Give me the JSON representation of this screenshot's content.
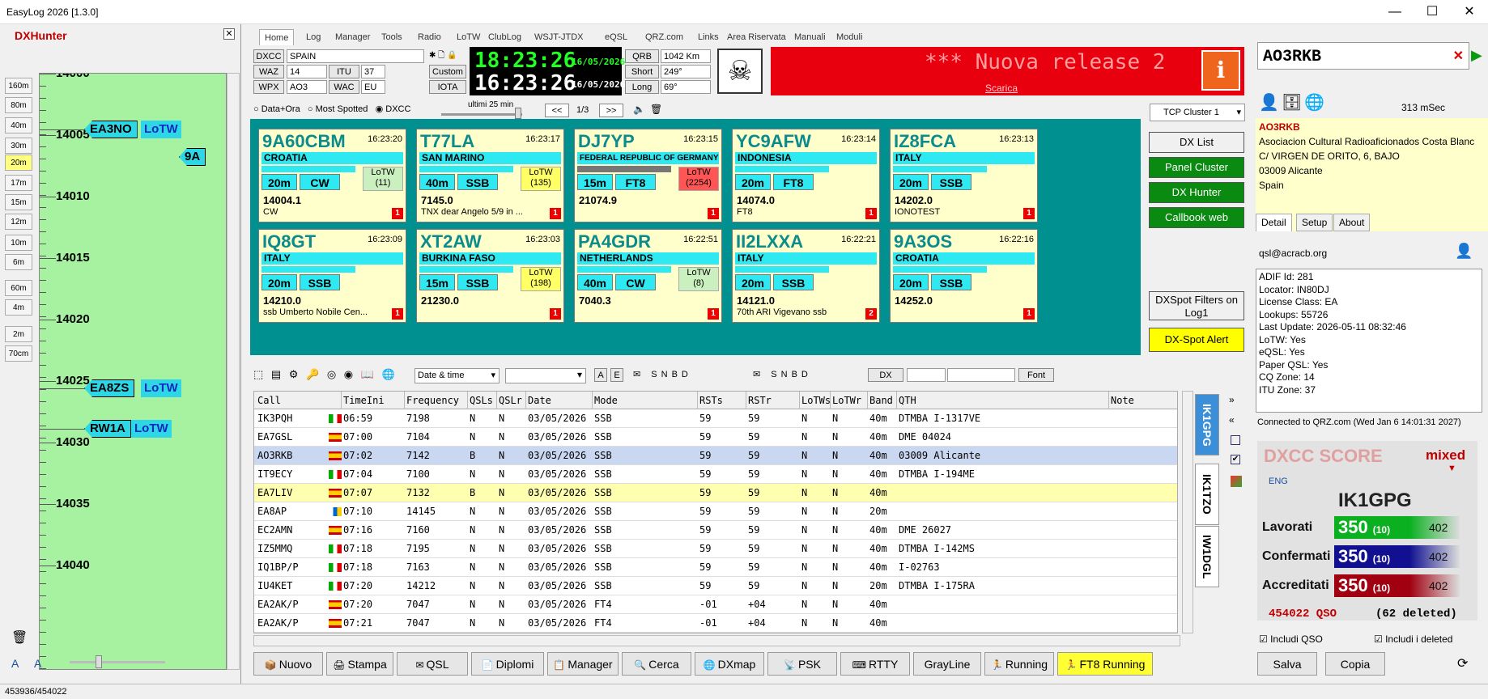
{
  "window": {
    "title": "EasyLog 2026 [1.3.0]",
    "minimize": "—",
    "maximize": "☐",
    "close": "✕"
  },
  "dxhunter": {
    "title": "DXHunter",
    "close": "✕",
    "bands": [
      "160m",
      "80m",
      "40m",
      "30m",
      "20m",
      "17m",
      "15m",
      "12m",
      "10m",
      "6m",
      "60m",
      "4m",
      "2m",
      "70cm"
    ],
    "freqs": [
      "14000",
      "14005",
      "14010",
      "14015",
      "14020",
      "14025",
      "14030",
      "14035",
      "14040"
    ],
    "spots": [
      {
        "call": "EA3NO",
        "lotw": "LoTW"
      },
      {
        "call": "EA8ZS",
        "lotw": "LoTW"
      },
      {
        "call": "RW1A",
        "lotw": "LoTW"
      },
      {
        "call": "9A",
        "lotw": ""
      }
    ]
  },
  "menu": [
    "Home",
    "Log",
    "Manager",
    "Tools",
    "Radio",
    "LoTW",
    "ClubLog",
    "WSJT-JTDX",
    "eQSL",
    "QRZ.com",
    "Links",
    "Area Riservata",
    "Manuali",
    "Moduli"
  ],
  "info": {
    "dxcc_l": "DXCC",
    "dxcc": "SPAIN",
    "waz_l": "WAZ",
    "waz": "14",
    "itu_l": "ITU",
    "itu": "37",
    "custom": "Custom",
    "wpx_l": "WPX",
    "wpx": "AO3",
    "wac_l": "WAC",
    "wac": "EU",
    "iota": "IOTA",
    "qrb_l": "QRB",
    "qrb": "1042 Km",
    "short_l": "Short",
    "short": "249°",
    "long_l": "Long",
    "long": "69°"
  },
  "clock": {
    "utc": "18:23:26",
    "local": "16:23:26",
    "date1": "16/05/2026",
    "date2": "16/05/2026"
  },
  "banner": {
    "text": "*** Nuova release 2",
    "link": "Scarica"
  },
  "filters": {
    "o1": "Data+Ora",
    "o2": "Most Spotted",
    "o3": "DXCC",
    "range": "ultimi 25 min",
    "prev": "<<",
    "page": "1/3",
    "next": ">>",
    "cluster": "TCP Cluster 1"
  },
  "cards": [
    {
      "call": "9A60CBM",
      "time": "16:23:20",
      "country": "CROATIA",
      "band": "20m",
      "mode": "CW",
      "lotw": "LoTW\n(11)",
      "lotwcolor": "#cbf0c0",
      "freq": "14004.1",
      "comment": "CW",
      "cnt": "1"
    },
    {
      "call": "T77LA",
      "time": "16:23:17",
      "country": "SAN MARINO",
      "band": "40m",
      "mode": "SSB",
      "lotw": "LoTW\n(135)",
      "lotwcolor": "#ffff66",
      "freq": "7145.0",
      "comment": "TNX dear Angelo 5/9 in ...",
      "cnt": "1"
    },
    {
      "call": "DJ7YP",
      "time": "16:23:15",
      "country": "FEDERAL REPUBLIC OF GERMANY",
      "band": "15m",
      "mode": "FT8",
      "lotw": "LoTW\n(2254)",
      "lotwcolor": "#ff5555",
      "freq": "21074.9",
      "comment": "",
      "cnt": "1"
    },
    {
      "call": "YC9AFW",
      "time": "16:23:14",
      "country": "INDONESIA",
      "band": "20m",
      "mode": "FT8",
      "lotw": "",
      "lotwcolor": "",
      "freq": "14074.0",
      "comment": "FT8",
      "cnt": "1"
    },
    {
      "call": "IZ8FCA",
      "time": "16:23:13",
      "country": "ITALY",
      "band": "20m",
      "mode": "SSB",
      "lotw": "",
      "lotwcolor": "",
      "freq": "14202.0",
      "comment": "IONOTEST",
      "cnt": "1"
    },
    {
      "call": "IQ8GT",
      "time": "16:23:09",
      "country": "ITALY",
      "band": "20m",
      "mode": "SSB",
      "lotw": "",
      "lotwcolor": "",
      "freq": "14210.0",
      "comment": "ssb Umberto Nobile Cen...",
      "cnt": "1"
    },
    {
      "call": "XT2AW",
      "time": "16:23:03",
      "country": "BURKINA FASO",
      "band": "15m",
      "mode": "SSB",
      "lotw": "LoTW\n(198)",
      "lotwcolor": "#ffff66",
      "freq": "21230.0",
      "comment": "",
      "cnt": "1"
    },
    {
      "call": "PA4GDR",
      "time": "16:22:51",
      "country": "NETHERLANDS",
      "band": "40m",
      "mode": "CW",
      "lotw": "LoTW\n(8)",
      "lotwcolor": "#cbf0c0",
      "freq": "7040.3",
      "comment": "",
      "cnt": "1"
    },
    {
      "call": "II2LXXA",
      "time": "16:22:21",
      "country": "ITALY",
      "band": "20m",
      "mode": "SSB",
      "lotw": "",
      "lotwcolor": "",
      "freq": "14121.0",
      "comment": "70th ARI Vigevano ssb",
      "cnt": "2"
    },
    {
      "call": "9A3OS",
      "time": "16:22:16",
      "country": "CROATIA",
      "band": "20m",
      "mode": "SSB",
      "lotw": "",
      "lotwcolor": "",
      "freq": "14252.0",
      "comment": "",
      "cnt": "1"
    }
  ],
  "sidebuttons": [
    {
      "label": "DX List",
      "bg": "#f0f0f0",
      "fg": "#000"
    },
    {
      "label": "Panel Cluster",
      "bg": "#0a8a10",
      "fg": "#fff"
    },
    {
      "label": "DX Hunter",
      "bg": "#0a8a10",
      "fg": "#fff"
    },
    {
      "label": "Callbook web",
      "bg": "#0a8a10",
      "fg": "#fff"
    }
  ],
  "dxspotfilter": "DXSpot Filters on Log1",
  "dxalert": "DX-Spot Alert",
  "toolbar": {
    "sort": "Date & time",
    "a": "A",
    "e": "E",
    "s": "S",
    "n": "N",
    "b": "B",
    "d": "D",
    "dx": "DX",
    "font": "Font"
  },
  "table": {
    "headers": [
      "Call",
      "TimeIni",
      "Frequency",
      "QSLs",
      "QSLr",
      "Date",
      "Mode",
      "RSTs",
      "RSTr",
      "LoTWs",
      "LoTWr",
      "Band",
      "QTH",
      "Note"
    ],
    "rows": [
      [
        "IK3PQH",
        "it",
        "06:59",
        "7198",
        "N",
        "N",
        "03/05/2026",
        "SSB",
        "59",
        "59",
        "N",
        "N",
        "40m",
        "DTMBA I-1317VE"
      ],
      [
        "EA7GSL",
        "es",
        "07:00",
        "7104",
        "N",
        "N",
        "03/05/2026",
        "SSB",
        "59",
        "59",
        "N",
        "N",
        "40m",
        "DME 04024"
      ],
      [
        "AO3RKB",
        "es",
        "07:02",
        "7142",
        "B",
        "N",
        "03/05/2026",
        "SSB",
        "59",
        "59",
        "N",
        "N",
        "40m",
        "03009 Alicante"
      ],
      [
        "IT9ECY",
        "it",
        "07:04",
        "7100",
        "N",
        "N",
        "03/05/2026",
        "SSB",
        "59",
        "59",
        "N",
        "N",
        "40m",
        "DTMBA I-194ME"
      ],
      [
        "EA7LIV",
        "es",
        "07:07",
        "7132",
        "B",
        "N",
        "03/05/2026",
        "SSB",
        "59",
        "59",
        "N",
        "N",
        "40m",
        ""
      ],
      [
        "EA8AP",
        "ic",
        "07:10",
        "14145",
        "N",
        "N",
        "03/05/2026",
        "SSB",
        "59",
        "59",
        "N",
        "N",
        "20m",
        ""
      ],
      [
        "EC2AMN",
        "es",
        "07:16",
        "7160",
        "N",
        "N",
        "03/05/2026",
        "SSB",
        "59",
        "59",
        "N",
        "N",
        "40m",
        "DME 26027"
      ],
      [
        "IZ5MMQ",
        "it",
        "07:18",
        "7195",
        "N",
        "N",
        "03/05/2026",
        "SSB",
        "59",
        "59",
        "N",
        "N",
        "40m",
        "DTMBA I-142MS"
      ],
      [
        "IQ1BP/P",
        "it",
        "07:18",
        "7163",
        "N",
        "N",
        "03/05/2026",
        "SSB",
        "59",
        "59",
        "N",
        "N",
        "40m",
        "I-02763"
      ],
      [
        "IU4KET",
        "it",
        "07:20",
        "14212",
        "N",
        "N",
        "03/05/2026",
        "SSB",
        "59",
        "59",
        "N",
        "N",
        "20m",
        "DTMBA I-175RA"
      ],
      [
        "EA2AK/P",
        "es",
        "07:20",
        "7047",
        "N",
        "N",
        "03/05/2026",
        "FT4",
        "-01",
        "+04",
        "N",
        "N",
        "40m",
        ""
      ],
      [
        "EA2AK/P",
        "es",
        "07:21",
        "7047",
        "N",
        "N",
        "03/05/2026",
        "FT4",
        "-01",
        "+04",
        "N",
        "N",
        "40m",
        ""
      ]
    ]
  },
  "optabs": [
    "IK1GPG",
    "IK1TZO",
    "IW1DGL"
  ],
  "bottom": [
    "Nuovo",
    "Stampa",
    "QSL",
    "Diplomi",
    "Manager",
    "Cerca",
    "DXmap",
    "PSK",
    "RTTY",
    "GrayLine",
    "Running",
    "FT8 Running"
  ],
  "status": "453936/454022",
  "right": {
    "callsign": "AO3RKB",
    "ms": "313 mSec",
    "name": "AO3RKB",
    "addr1": "Asociacion Cultural Radioaficionados Costa Blanc",
    "addr2": "C/ VIRGEN DE ORITO, 6, BAJO",
    "addr3": "03009 Alicante",
    "addr4": "Spain",
    "tabs": [
      "Detail",
      "Setup",
      "About"
    ],
    "email": "qsl@acracb.org",
    "details": [
      "ADIF Id: 281",
      "Locator: IN80DJ",
      "License Class: EA",
      "Lookups: 55726",
      "Last Update: 2026-05-11 08:32:46",
      "LoTW: Yes",
      "eQSL: Yes",
      "Paper QSL: Yes",
      "CQ Zone: 14",
      "ITU Zone: 37"
    ],
    "connected": "Connected to QRZ.com (Wed Jan  6 14:01:31 2027)"
  },
  "score": {
    "title": "DXCC SCORE",
    "mode": "mixed",
    "lang": "ENG",
    "call": "IK1GPG",
    "rows": [
      {
        "label": "Lavorati",
        "val": "350",
        "sub": "(10)",
        "tot": "402",
        "bg": "#0ab020"
      },
      {
        "label": "Confermati",
        "val": "350",
        "sub": "(10)",
        "tot": "402",
        "bg": "#101090"
      },
      {
        "label": "Accreditati",
        "val": "350",
        "sub": "(10)",
        "tot": "402",
        "bg": "#a00010"
      }
    ],
    "qso": "454022 QSO",
    "deleted": "(62 deleted)",
    "inc1": "Includi QSO",
    "inc2": "Includi i deleted",
    "save": "Salva",
    "copy": "Copia"
  }
}
